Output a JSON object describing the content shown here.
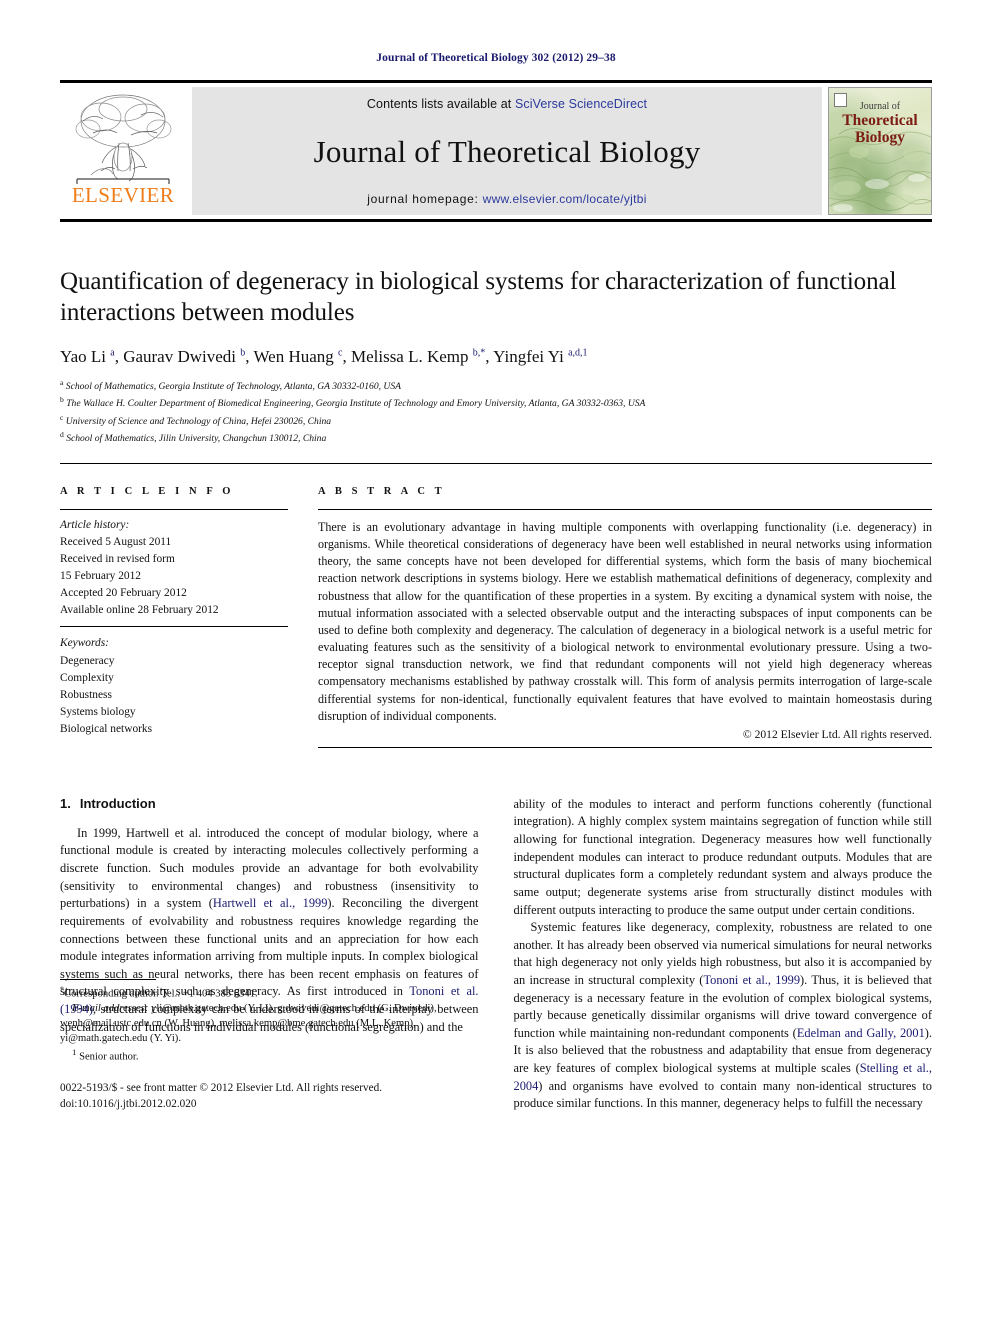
{
  "running_head": "Journal of Theoretical Biology 302 (2012) 29–38",
  "masthead": {
    "contents_prefix": "Contents lists available at ",
    "sciencedirect": "SciVerse ScienceDirect",
    "journal_name": "Journal of Theoretical Biology",
    "homepage_prefix": "journal homepage: ",
    "homepage_url": "www.elsevier.com/locate/yjtbi",
    "publisher_logo_text": "ELSEVIER",
    "publisher_accent_color": "#ef7d1a",
    "link_color": "#2b3a9c",
    "cover": {
      "line1": "Journal of",
      "line2": "Theoretical",
      "line3": "Biology",
      "text_color": "#7c1b13"
    }
  },
  "article": {
    "title": "Quantification of degeneracy in biological systems for characterization of functional interactions between modules",
    "authors_html": "Yao Li <sup>a</sup>, Gaurav Dwivedi <sup>b</sup>, Wen Huang <sup>c</sup>, Melissa L. Kemp <sup>b,*</sup>, Yingfei Yi <sup>a,d,1</sup>",
    "affiliations": [
      {
        "marker": "a",
        "text": "School of Mathematics, Georgia Institute of Technology, Atlanta, GA 30332-0160, USA"
      },
      {
        "marker": "b",
        "text": "The Wallace H. Coulter Department of Biomedical Engineering, Georgia Institute of Technology and Emory University, Atlanta, GA 30332-0363, USA"
      },
      {
        "marker": "c",
        "text": "University of Science and Technology of China, Hefei 230026, China"
      },
      {
        "marker": "d",
        "text": "School of Mathematics, Jilin University, Changchun 130012, China"
      }
    ]
  },
  "article_info": {
    "heading": "A R T I C L E   I N F O",
    "history_label": "Article history:",
    "history": [
      "Received 5 August 2011",
      "Received in revised form",
      "15 February 2012",
      "Accepted 20 February 2012",
      "Available online 28 February 2012"
    ],
    "keywords_label": "Keywords:",
    "keywords": [
      "Degeneracy",
      "Complexity",
      "Robustness",
      "Systems biology",
      "Biological networks"
    ]
  },
  "abstract": {
    "heading": "A B S T R A C T",
    "text": "There is an evolutionary advantage in having multiple components with overlapping functionality (i.e. degeneracy) in organisms. While theoretical considerations of degeneracy have been well established in neural networks using information theory, the same concepts have not been developed for differential systems, which form the basis of many biochemical reaction network descriptions in systems biology. Here we establish mathematical definitions of degeneracy, complexity and robustness that allow for the quantification of these properties in a system. By exciting a dynamical system with noise, the mutual information associated with a selected observable output and the interacting subspaces of input components can be used to define both complexity and degeneracy. The calculation of degeneracy in a biological network is a useful metric for evaluating features such as the sensitivity of a biological network to environmental evolutionary pressure. Using a two-receptor signal transduction network, we find that redundant components will not yield high degeneracy whereas compensatory mechanisms established by pathway crosstalk will. This form of analysis permits interrogation of large-scale differential systems for non-identical, functionally equivalent features that have evolved to maintain homeostasis during disruption of individual components.",
    "copyright": "© 2012 Elsevier Ltd. All rights reserved."
  },
  "body": {
    "section_number": "1.",
    "section_title": "Introduction",
    "left_paragraph_1_html": "In 1999, Hartwell et al. introduced the concept of modular biology, where a functional module is created by interacting molecules collectively performing a discrete function. Such modules provide an advantage for both evolvability (sensitivity to environmental changes) and robustness (insensitivity to perturbations) in a system (<span class=\"cite\">Hartwell et al., 1999</span>). Reconciling the divergent requirements of evolvability and robustness requires knowledge regarding the connections between these functional units and an appreciation for how each module integrates information arriving from multiple inputs. In complex biological systems such as neural networks, there has been recent emphasis on features of structural complexity such as degeneracy. As first introduced in <span class=\"cite\">Tononi et al. (1994)</span>, structural complexity can be understood in terms of the interplay between specialization of functions in individual modules (functional segregation) and the",
    "right_paragraph_1_html": "ability of the modules to interact and perform functions coherently (functional integration). A highly complex system maintains segregation of function while still allowing for functional integration. Degeneracy measures how well functionally independent modules can interact to produce redundant outputs. Modules that are structural duplicates form a completely redundant system and always produce the same output; degenerate systems arise from structurally distinct modules with different outputs interacting to produce the same output under certain conditions.",
    "right_paragraph_2_html": "Systemic features like degeneracy, complexity, robustness are related to one another. It has already been observed via numerical simulations for neural networks that high degeneracy not only yields high robustness, but also it is accompanied by an increase in structural complexity (<span class=\"cite\">Tononi et al., 1999</span>). Thus, it is believed that degeneracy is a necessary feature in the evolution of complex biological systems, partly because genetically dissimilar organisms will drive toward convergence of function while maintaining non-redundant components (<span class=\"cite\">Edelman and Gally, 2001</span>). It is also believed that the robustness and adaptability that ensue from degeneracy are key features of complex biological systems at multiple scales (<span class=\"cite\">Stelling et al., 2004</span>) and organisms have evolved to contain many non-identical structures to produce similar functions. In this manner, degeneracy helps to fulfill the necessary"
  },
  "footnotes": {
    "corresponding_html": "<span class=\"star\">*</span>Corresponding author. Tel.: +1 404 385 6341.",
    "emails_html": "<span class=\"em\">E-mail addresses:</span> yli@math.gatech.edu (Y. Li), g.dwivedi@gatech.edu (G. Dwivedi), wenh@mail.ustc.edu.cn (W. Huang), melissa.kemp@bme.gatech.edu (M.L. Kemp), yi@math.gatech.edu (Y. Yi).",
    "senior_html": "<sup>1</sup> Senior author.",
    "issn_line1": "0022-5193/$ - see front matter © 2012 Elsevier Ltd. All rights reserved.",
    "issn_line2": "doi:10.1016/j.jtbi.2012.02.020"
  }
}
